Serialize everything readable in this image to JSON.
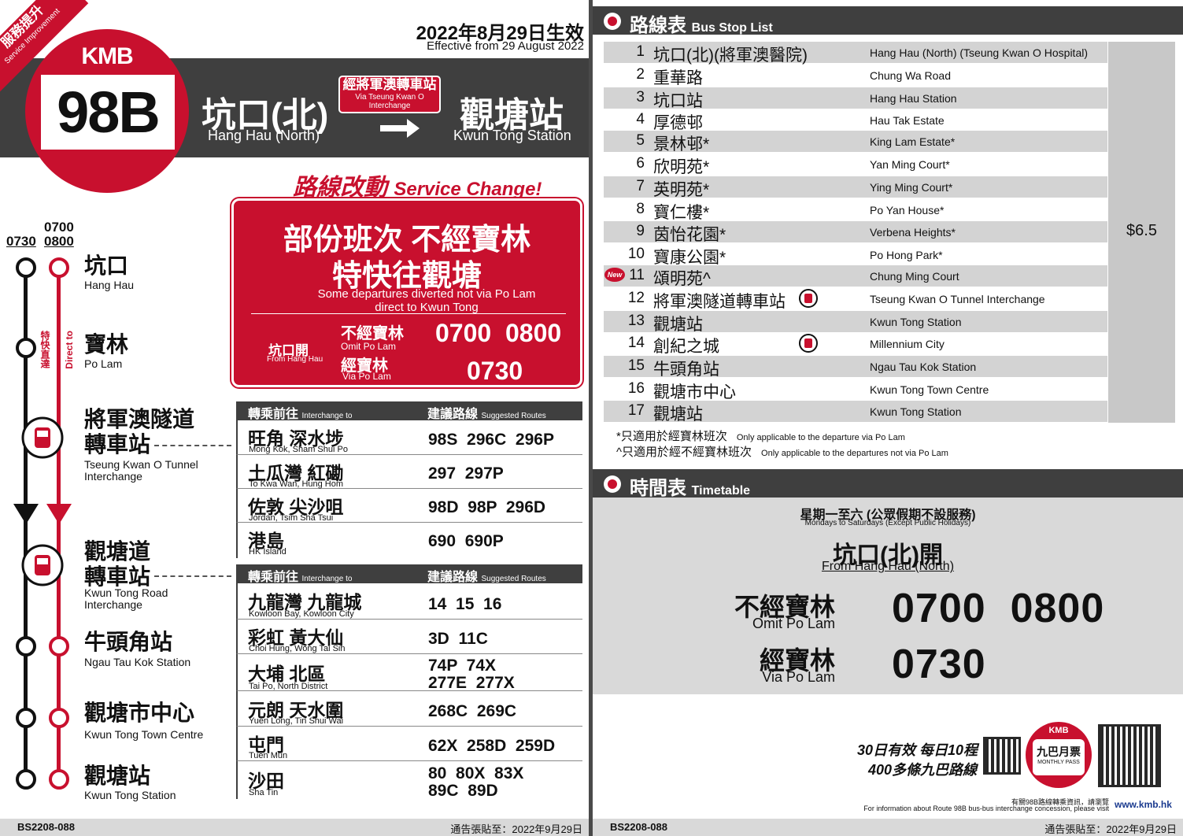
{
  "header": {
    "corner_zh": "服務提升",
    "corner_en": "Service Improvement",
    "logo": "KMB",
    "route": "98B",
    "effective_zh": "2022年8月29日生效",
    "effective_en": "Effective from 29 August 2022",
    "origin_zh": "坑口(北)",
    "origin_en": "Hang Hau (North)",
    "dest_zh": "觀塘站",
    "dest_en": "Kwun Tong Station",
    "via_zh": "經將軍澳轉車站",
    "via_en": "Via Tseung Kwan O Interchange"
  },
  "service_change": {
    "title_zh": "路線改動",
    "title_en": "Service Change!",
    "line1": "部份班次 不經寶林",
    "line2": "特快往觀塘",
    "en": "Some departures diverted not via Po Lam direct to Kwun Tong",
    "from_zh": "坑口開",
    "from_en": "From Hang Hau",
    "omit_zh": "不經寶林",
    "omit_en": "Omit Po Lam",
    "omit_times": "0700  0800",
    "via_zh": "經寶林",
    "via_en": "Via Po Lam",
    "via_times": "0730"
  },
  "diagram": {
    "col1_time": "0730",
    "col2_time_top": "0700",
    "col2_time_bottom": "0800",
    "express_zh": "特快直達",
    "express_en": "Direct to",
    "stations": [
      {
        "zh": "坑口",
        "en": "Hang Hau"
      },
      {
        "zh": "寶林",
        "en": "Po Lam"
      },
      {
        "zh": "將軍澳隧道\n轉車站",
        "en": "Tseung Kwan O Tunnel\nInterchange"
      },
      {
        "zh": "觀塘道\n轉車站",
        "en": "Kwun Tong Road\nInterchange"
      },
      {
        "zh": "牛頭角站",
        "en": "Ngau Tau Kok Station"
      },
      {
        "zh": "觀塘市中心",
        "en": "Kwun Tong Town Centre"
      },
      {
        "zh": "觀塘站",
        "en": "Kwun Tong Station"
      }
    ]
  },
  "interchange": {
    "head_a_zh": "轉乘前往",
    "head_a_en": "Interchange to",
    "head_b_zh": "建議路線",
    "head_b_en": "Suggested Routes",
    "table1": [
      {
        "zh": "旺角 深水埗",
        "en": "Mong Kok, Sham Shui Po",
        "routes": "98S  296C  296P"
      },
      {
        "zh": "土瓜灣 紅磡",
        "en": "To Kwa Wan, Hung Hom",
        "routes": "297  297P"
      },
      {
        "zh": "佐敦 尖沙咀",
        "en": "Jordan, Tsim Sha Tsui",
        "routes": "98D  98P  296D"
      },
      {
        "zh": "港島",
        "en": "HK Island",
        "routes": "690  690P"
      }
    ],
    "table2": [
      {
        "zh": "九龍灣 九龍城",
        "en": "Kowloon Bay, Kowloon City",
        "routes": "14  15  16"
      },
      {
        "zh": "彩虹 黃大仙",
        "en": "Choi Hung, Wong Tai Sin",
        "routes": "3D  11C"
      },
      {
        "zh": "大埔 北區",
        "en": "Tai Po, North District",
        "routes": "74P  74X\n277E  277X"
      },
      {
        "zh": "元朗 天水圍",
        "en": "Yuen Long, Tin Shui Wai",
        "routes": "268C  269C"
      },
      {
        "zh": "屯門",
        "en": "Tuen Mun",
        "routes": "62X  258D  259D"
      },
      {
        "zh": "沙田",
        "en": "Sha Tin",
        "routes": "80  80X  83X\n89C  89D"
      }
    ]
  },
  "footer": {
    "code": "BS2208-088",
    "posted": "通告張貼至：2022年9月29日"
  },
  "stop_list": {
    "title_zh": "路線表",
    "title_en": "Bus Stop List",
    "fare": "$6.5",
    "new_label": "New",
    "stops": [
      {
        "n": "1",
        "zh": "坑口(北)(將軍澳醫院)",
        "en": "Hang Hau (North) (Tseung Kwan O Hospital)"
      },
      {
        "n": "2",
        "zh": "重華路",
        "en": "Chung Wa Road"
      },
      {
        "n": "3",
        "zh": "坑口站",
        "en": "Hang Hau Station"
      },
      {
        "n": "4",
        "zh": "厚德邨",
        "en": "Hau Tak Estate"
      },
      {
        "n": "5",
        "zh": "景林邨*",
        "en": "King Lam Estate*"
      },
      {
        "n": "6",
        "zh": "欣明苑*",
        "en": "Yan Ming Court*"
      },
      {
        "n": "7",
        "zh": "英明苑*",
        "en": "Ying Ming Court*"
      },
      {
        "n": "8",
        "zh": "寶仁樓*",
        "en": "Po Yan House*"
      },
      {
        "n": "9",
        "zh": "茵怡花園*",
        "en": "Verbena Heights*"
      },
      {
        "n": "10",
        "zh": "寶康公園*",
        "en": "Po Hong Park*"
      },
      {
        "n": "11",
        "zh": "頌明苑^",
        "en": "Chung Ming Court"
      },
      {
        "n": "12",
        "zh": "將軍澳隧道轉車站",
        "en": "Tseung Kwan O Tunnel Interchange"
      },
      {
        "n": "13",
        "zh": "觀塘站",
        "en": "Kwun Tong Station"
      },
      {
        "n": "14",
        "zh": "創紀之城",
        "en": "Millennium City"
      },
      {
        "n": "15",
        "zh": "牛頭角站",
        "en": "Ngau Tau Kok Station"
      },
      {
        "n": "16",
        "zh": "觀塘市中心",
        "en": "Kwun Tong Town Centre"
      },
      {
        "n": "17",
        "zh": "觀塘站",
        "en": "Kwun Tong Station"
      }
    ],
    "note1_zh": "*只適用於經寶林班次",
    "note1_en": "Only applicable to the departure via Po Lam",
    "note2_zh": "^只適用於經不經寶林班次",
    "note2_en": "Only applicable to the departures not via Po Lam"
  },
  "timetable": {
    "title_zh": "時間表",
    "title_en": "Timetable",
    "days_zh": "星期一至六 (公眾假期不設服務)",
    "days_en": "Mondays to Saturdays (Except Public Holidays)",
    "from_zh": "坑口(北)開",
    "from_en": "From Hang Hau (North)",
    "omit_zh": "不經寶林",
    "omit_en": "Omit Po Lam",
    "omit_times": "0700  0800",
    "via_zh": "經寶林",
    "via_en": "Via Po Lam",
    "via_times": "0730"
  },
  "promo": {
    "line1": "30日有效 每日10程",
    "line2": "400多條九巴路線",
    "pass_logo": "KMB",
    "pass_zh": "九巴月票",
    "pass_en": "MONTHLY PASS",
    "info_zh": "有關98B路線轉乘資訊，請瀏覽",
    "info_en": "For information about Route 98B bus-bus interchange concession, please visit",
    "url": "www.kmb.hk"
  }
}
